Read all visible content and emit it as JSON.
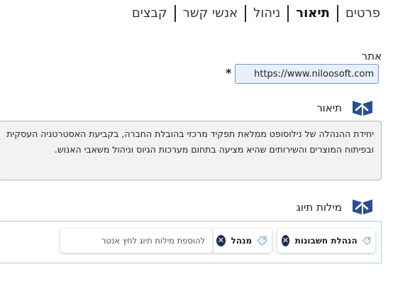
{
  "tabs": [
    {
      "label": "פרטים",
      "active": false
    },
    {
      "label": "תיאור",
      "active": true
    },
    {
      "label": "ניהול",
      "active": false
    },
    {
      "label": "אנשי קשר",
      "active": false
    },
    {
      "label": "קבצים",
      "active": false
    }
  ],
  "site": {
    "label": "אתר",
    "required_mark": "*",
    "value": "https://www.niloosoft.com"
  },
  "description": {
    "title": "תיאור",
    "icon": "book-icon",
    "text": "יחידת ההנהלה של נילוסופט ממלאת תפקיד מרכזי בהובלת החברה, בקביעת האסטרטגיה העסקית ובפיתוח המוצרים והשירותים שהיא מציעה בתחום מערכות הגיוס וניהול משאבי האנוש."
  },
  "tags": {
    "title": "מילות תיוג",
    "icon": "book-icon",
    "items": [
      {
        "label": "הנהלת חשבונות",
        "icon": "tag-icon"
      },
      {
        "label": "מנהל",
        "icon": "tag-icon"
      }
    ],
    "input_placeholder": "להוספת מילות תיוג לחץ אנטר"
  },
  "colors": {
    "accent": "#2a4f8e",
    "input_bg": "#e8f0fe",
    "tag_remove": "#1f2f4a"
  }
}
